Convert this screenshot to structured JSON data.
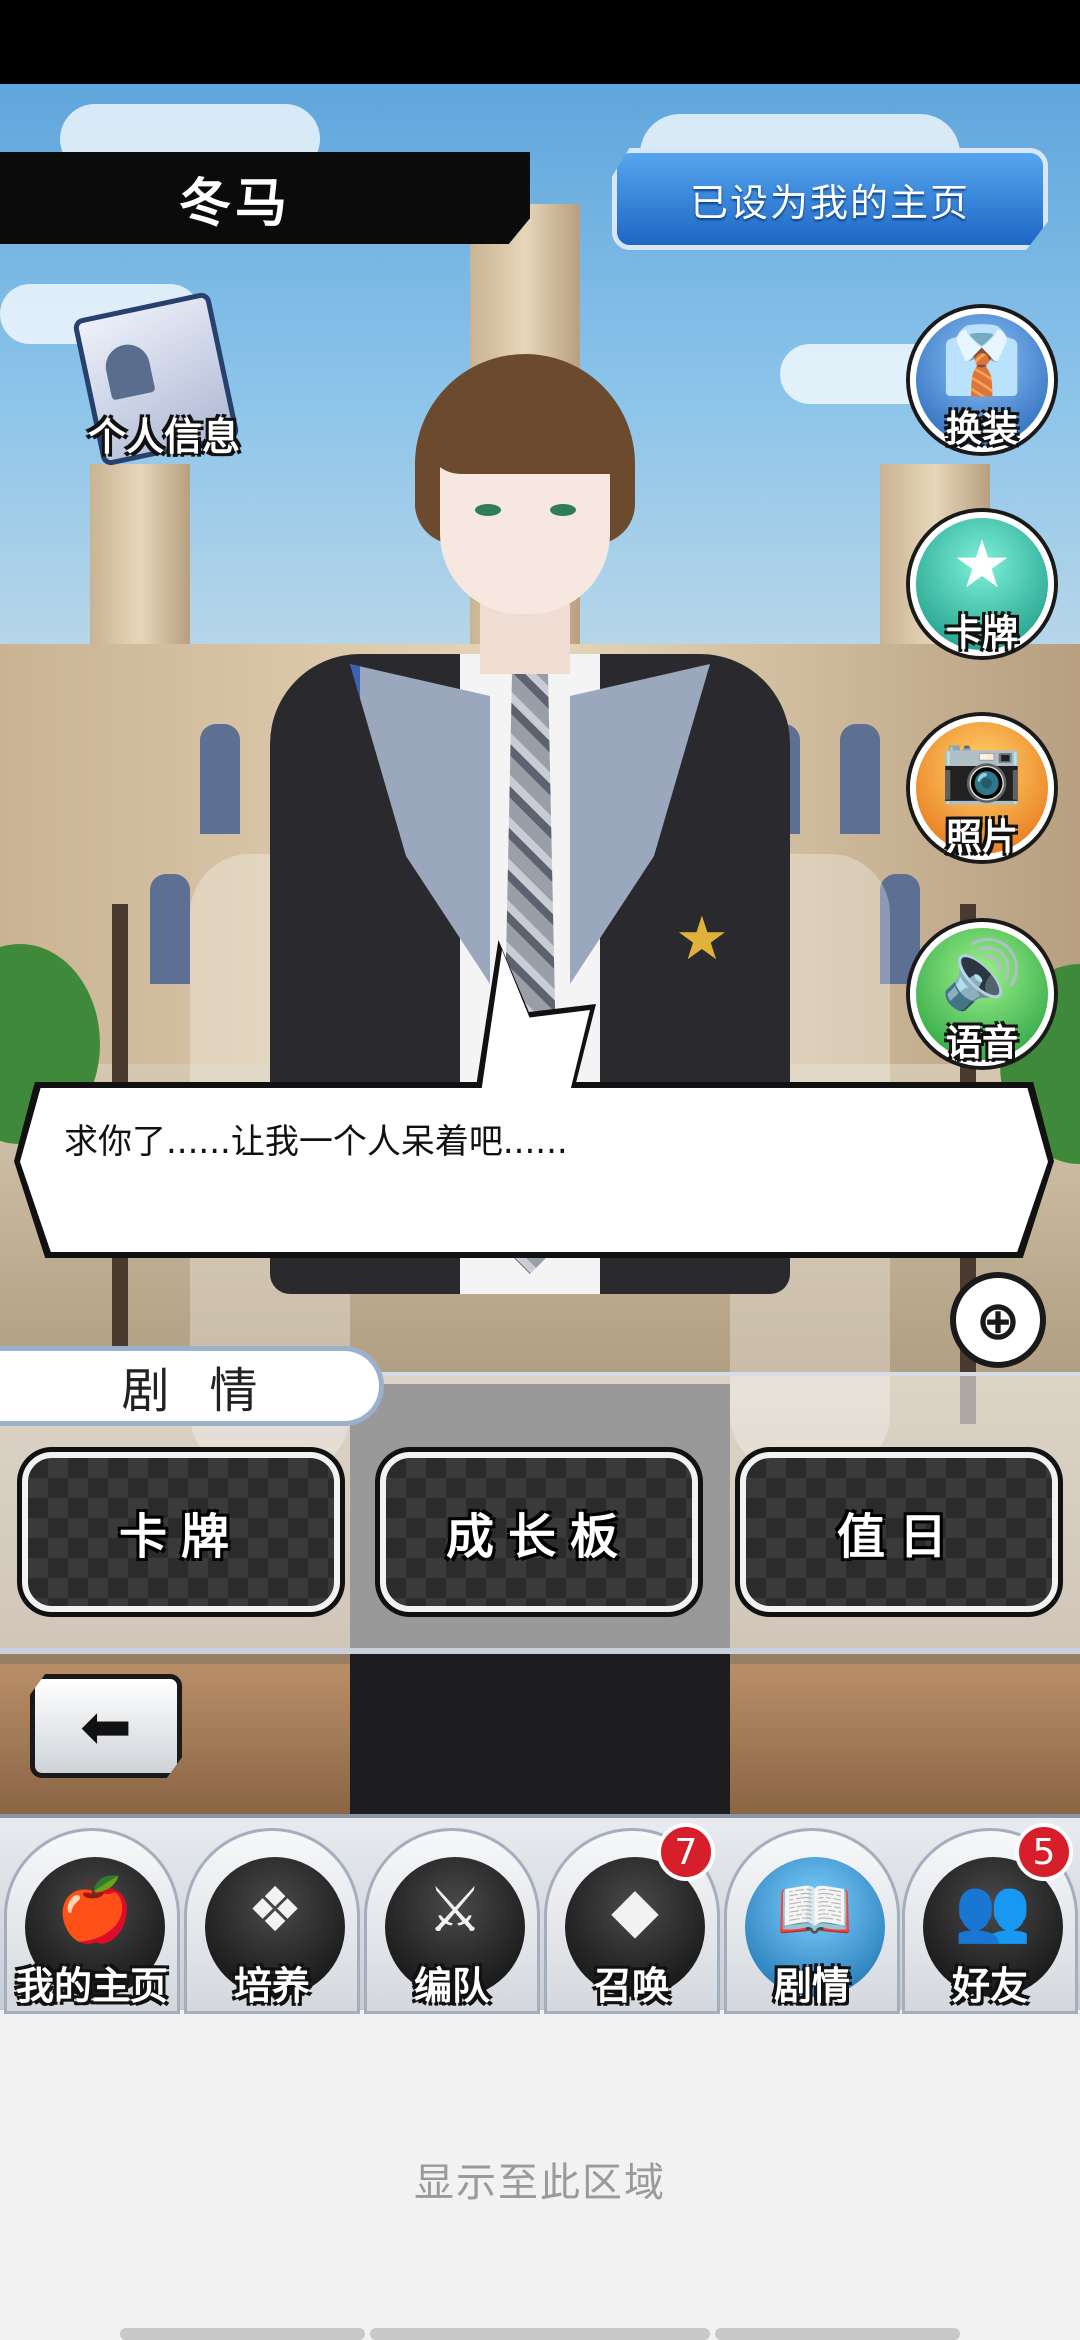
{
  "header": {
    "character_name": "冬马",
    "home_button_label": "已设为我的主页"
  },
  "profile": {
    "label": "个人信息",
    "icon": "id-card-icon"
  },
  "side_menu": [
    {
      "label": "换装",
      "icon": "outfit-icon",
      "glyph": "👔"
    },
    {
      "label": "卡牌",
      "icon": "star-icon",
      "glyph": "★"
    },
    {
      "label": "照片",
      "icon": "camera-icon",
      "glyph": "📷"
    },
    {
      "label": "语音",
      "icon": "speaker-icon",
      "glyph": "🔊"
    }
  ],
  "dialogue": {
    "text": "求你了......让我一个人呆着吧......"
  },
  "zoom": {
    "icon": "zoom-in-icon",
    "glyph": "⊕"
  },
  "story_panel": {
    "title": "剧情",
    "buttons": [
      "卡牌",
      "成长板",
      "值日"
    ]
  },
  "back": {
    "icon": "back-arrow-icon",
    "glyph": "⬅"
  },
  "bottom_nav": [
    {
      "label": "我的主页",
      "icon": "apple-icon",
      "glyph": "🍎",
      "badge": ""
    },
    {
      "label": "培养",
      "icon": "gem-cluster-icon",
      "glyph": "❖",
      "badge": ""
    },
    {
      "label": "编队",
      "icon": "crossed-swords-icon",
      "glyph": "⚔",
      "badge": ""
    },
    {
      "label": "召唤",
      "icon": "diamond-icon",
      "glyph": "◆",
      "badge": "7"
    },
    {
      "label": "剧情",
      "icon": "book-icon",
      "glyph": "📖",
      "badge": ""
    },
    {
      "label": "好友",
      "icon": "friends-icon",
      "glyph": "👥",
      "badge": "5"
    }
  ],
  "system": {
    "display_area_hint": "显示至此区域"
  },
  "colors": {
    "accent_blue": "#1f66c5",
    "badge_red": "#d61f2a",
    "panel_dark": "#2b2b2b"
  }
}
